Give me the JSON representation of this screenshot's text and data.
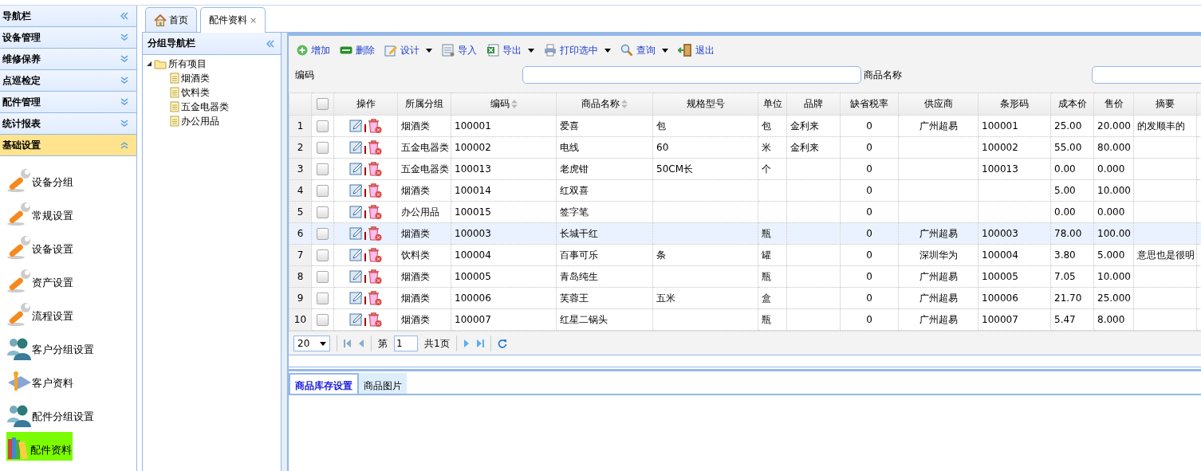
{
  "sidebar": {
    "title": "导航栏",
    "sections": [
      {
        "label": "设备管理",
        "expanded": false
      },
      {
        "label": "维修保养",
        "expanded": false
      },
      {
        "label": "点巡检定",
        "expanded": false
      },
      {
        "label": "配件管理",
        "expanded": false
      },
      {
        "label": "统计报表",
        "expanded": false
      },
      {
        "label": "基础设置",
        "expanded": true
      }
    ],
    "items": [
      {
        "label": "设备分组",
        "kind": "wrench",
        "selected": false
      },
      {
        "label": "常规设置",
        "kind": "wrench",
        "selected": false
      },
      {
        "label": "设备设置",
        "kind": "wrench",
        "selected": false
      },
      {
        "label": "资产设置",
        "kind": "wrench",
        "selected": false
      },
      {
        "label": "流程设置",
        "kind": "wrench",
        "selected": false
      },
      {
        "label": "客户分组设置",
        "kind": "users",
        "selected": false
      },
      {
        "label": "客户资料",
        "kind": "contact",
        "selected": false
      },
      {
        "label": "配件分组设置",
        "kind": "users",
        "selected": false
      },
      {
        "label": "配件资料",
        "kind": "books",
        "selected": true
      }
    ]
  },
  "tabs": [
    {
      "label": "首页",
      "kind": "home",
      "selected": false
    },
    {
      "label": "配件资料",
      "kind": "closable",
      "close": "×",
      "selected": true
    }
  ],
  "group_nav": {
    "title": "分组导航栏",
    "tree": {
      "label": "所有项目",
      "expanded": true,
      "children": [
        {
          "label": "烟酒类"
        },
        {
          "label": "饮料类"
        },
        {
          "label": "五金电器类"
        },
        {
          "label": "办公用品"
        }
      ]
    }
  },
  "toolbar": [
    {
      "label": "增加",
      "kind": "add",
      "dropdown": false
    },
    {
      "label": "删除",
      "kind": "remove",
      "dropdown": false
    },
    {
      "label": "设计",
      "kind": "design",
      "dropdown": true
    },
    {
      "label": "导入",
      "kind": "import",
      "dropdown": false
    },
    {
      "label": "导出",
      "kind": "export",
      "dropdown": true
    },
    {
      "label": "打印选中",
      "kind": "print",
      "dropdown": true
    },
    {
      "label": "查询",
      "kind": "search",
      "dropdown": true
    },
    {
      "label": "退出",
      "kind": "exit",
      "dropdown": false
    }
  ],
  "query": [
    {
      "label": "编码"
    },
    {
      "label": "商品名称"
    }
  ],
  "table": {
    "select_all_checked": false,
    "columns": [
      {
        "label": "操作",
        "sortable": false
      },
      {
        "label": "所属分组",
        "sortable": false
      },
      {
        "label": "编码",
        "sortable": true
      },
      {
        "label": "商品名称",
        "sortable": true
      },
      {
        "label": "规格型号",
        "sortable": false
      },
      {
        "label": "单位",
        "sortable": false
      },
      {
        "label": "品牌",
        "sortable": false
      },
      {
        "label": "缺省税率",
        "sortable": false
      },
      {
        "label": "供应商",
        "sortable": false
      },
      {
        "label": "条形码",
        "sortable": false
      },
      {
        "label": "成本价",
        "sortable": false
      },
      {
        "label": "售价",
        "sortable": false
      },
      {
        "label": "摘要",
        "sortable": false
      }
    ],
    "rows": [
      {
        "num": "1",
        "checked": false,
        "highlighted": false,
        "cells": [
          "",
          "烟酒类",
          "100001",
          "爱喜",
          "包",
          "包",
          "金利来",
          "0",
          "广州超易",
          "100001",
          "25.00",
          "20.000",
          "的发顺丰的"
        ]
      },
      {
        "num": "2",
        "checked": false,
        "highlighted": false,
        "cells": [
          "",
          "五金电器类",
          "100002",
          "电线",
          "60",
          "米",
          "金利来",
          "0",
          "",
          "100002",
          "55.00",
          "80.000",
          ""
        ]
      },
      {
        "num": "3",
        "checked": false,
        "highlighted": false,
        "cells": [
          "",
          "五金电器类",
          "100013",
          "老虎钳",
          "50CM长",
          "个",
          "",
          "0",
          "",
          "100013",
          "0.00",
          "0.000",
          ""
        ]
      },
      {
        "num": "4",
        "checked": false,
        "highlighted": false,
        "cells": [
          "",
          "烟酒类",
          "100014",
          "红双喜",
          "",
          "",
          "",
          "0",
          "",
          "",
          "5.00",
          "10.000",
          ""
        ]
      },
      {
        "num": "5",
        "checked": false,
        "highlighted": false,
        "cells": [
          "",
          "办公用品",
          "100015",
          "签字笔",
          "",
          "",
          "",
          "0",
          "",
          "",
          "0.00",
          "0.000",
          ""
        ]
      },
      {
        "num": "6",
        "checked": false,
        "highlighted": true,
        "cells": [
          "",
          "烟酒类",
          "100003",
          "长城干红",
          "",
          "瓶",
          "",
          "0",
          "广州超易",
          "100003",
          "78.00",
          "100.00",
          ""
        ]
      },
      {
        "num": "7",
        "checked": false,
        "highlighted": false,
        "cells": [
          "",
          "饮料类",
          "100004",
          "百事可乐",
          "条",
          "罐",
          "",
          "0",
          "深圳华为",
          "100004",
          "3.80",
          "5.000",
          "意思也是很明"
        ]
      },
      {
        "num": "8",
        "checked": false,
        "highlighted": false,
        "cells": [
          "",
          "烟酒类",
          "100005",
          "青岛纯生",
          "",
          "瓶",
          "",
          "0",
          "广州超易",
          "100005",
          "7.05",
          "10.000",
          ""
        ]
      },
      {
        "num": "9",
        "checked": false,
        "highlighted": false,
        "cells": [
          "",
          "烟酒类",
          "100006",
          "芙蓉王",
          "五米",
          "盒",
          "",
          "0",
          "广州超易",
          "100006",
          "21.70",
          "25.000",
          ""
        ]
      },
      {
        "num": "10",
        "checked": false,
        "highlighted": false,
        "cells": [
          "",
          "烟酒类",
          "100007",
          "红星二锅头",
          "",
          "瓶",
          "",
          "0",
          "广州超易",
          "100007",
          "5.47",
          "8.000",
          ""
        ]
      }
    ]
  },
  "pager": {
    "page_size": "20",
    "page_prefix": "第",
    "page": "1",
    "total": "共1页"
  },
  "bottom_tabs": [
    {
      "label": "商品库存设置",
      "selected": true
    },
    {
      "label": "商品图片",
      "selected": false
    }
  ]
}
